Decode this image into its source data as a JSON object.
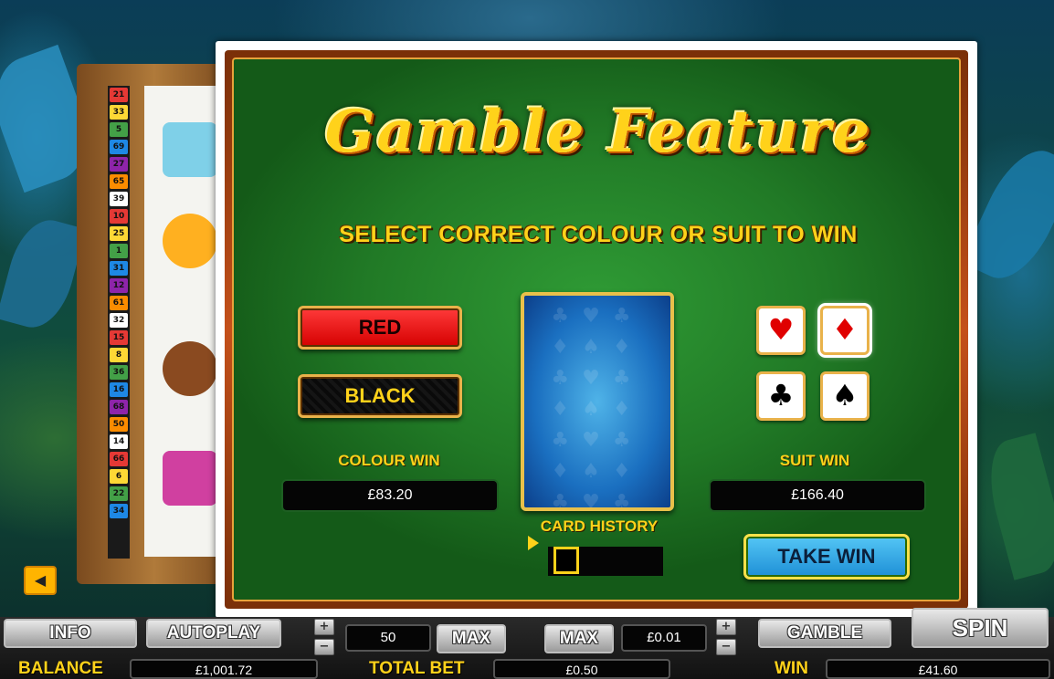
{
  "gamble": {
    "title": "Gamble Feature",
    "instruction": "SELECT CORRECT COLOUR OR SUIT TO WIN",
    "red_label": "RED",
    "black_label": "BLACK",
    "colour_win_label": "COLOUR WIN",
    "colour_win_value": "£83.20",
    "suit_win_label": "SUIT WIN",
    "suit_win_value": "£166.40",
    "card_history_label": "CARD HISTORY",
    "take_win_label": "TAKE WIN",
    "suits": [
      {
        "name": "hearts",
        "glyph": "♥",
        "color": "#e00000"
      },
      {
        "name": "diamonds",
        "glyph": "♦",
        "color": "#e00000",
        "selected": true
      },
      {
        "name": "clubs",
        "glyph": "♣",
        "color": "#000000"
      },
      {
        "name": "spades",
        "glyph": "♠",
        "color": "#000000"
      }
    ]
  },
  "reel_numbers": [
    "21",
    "33",
    "5",
    "69",
    "27",
    "65",
    "39",
    "10",
    "25",
    "1",
    "31",
    "12",
    "61",
    "32",
    "15",
    "8",
    "36",
    "16",
    "68",
    "50",
    "14",
    "66",
    "6",
    "22",
    "34"
  ],
  "bottom": {
    "info_label": "INFO",
    "autoplay_label": "AUTOPLAY",
    "lines_value": "50",
    "max_label": "MAX",
    "max2_label": "MAX",
    "coin_value": "£0.01",
    "gamble_label": "GAMBLE",
    "spin_label": "SPIN",
    "balance_label": "BALANCE",
    "balance_value": "£1,001.72",
    "total_bet_label": "TOTAL BET",
    "total_bet_value": "£0.50",
    "win_label": "WIN",
    "win_value": "£41.60"
  },
  "colors": {
    "accent_gold": "#ffd21a",
    "felt_green": "#217a26",
    "frame_orange": "#c4501a"
  }
}
